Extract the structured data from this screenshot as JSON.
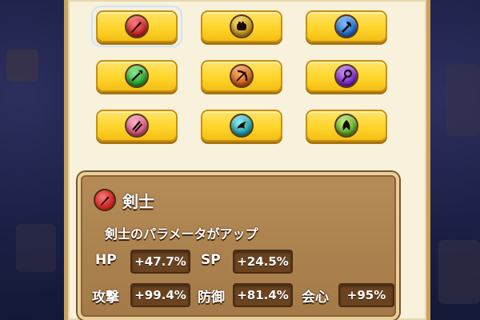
{
  "class_buttons": [
    {
      "name": "swordsman",
      "icon": "sword-icon",
      "color": "#e02a2a",
      "selected": true
    },
    {
      "name": "warrior",
      "icon": "fist-icon",
      "color": "#d8a417",
      "selected": false
    },
    {
      "name": "axeman",
      "icon": "axe-icon",
      "color": "#2a7be0",
      "selected": false
    },
    {
      "name": "lancer",
      "icon": "spear-icon",
      "color": "#2dbb35",
      "selected": false
    },
    {
      "name": "archer",
      "icon": "bow-icon",
      "color": "#f07a1e",
      "selected": false
    },
    {
      "name": "mage",
      "icon": "staff-icon",
      "color": "#9a3ae0",
      "selected": false
    },
    {
      "name": "dual-blade",
      "icon": "twin-blade-icon",
      "color": "#f07ea5",
      "selected": false
    },
    {
      "name": "beast",
      "icon": "claw-icon",
      "color": "#2ac9d8",
      "selected": false
    },
    {
      "name": "healer",
      "icon": "leaf-icon",
      "color": "#7ed82a",
      "selected": false
    }
  ],
  "info": {
    "class_name": "剣士",
    "description": "剣士のパラメータがアップ",
    "stats": {
      "hp_label": "HP",
      "hp_value": "+47.7%",
      "sp_label": "SP",
      "sp_value": "+24.5%",
      "atk_label": "攻撃",
      "atk_value": "+99.4%",
      "def_label": "防御",
      "def_value": "+81.4%",
      "crit_label": "会心",
      "crit_value": "+95%"
    }
  }
}
